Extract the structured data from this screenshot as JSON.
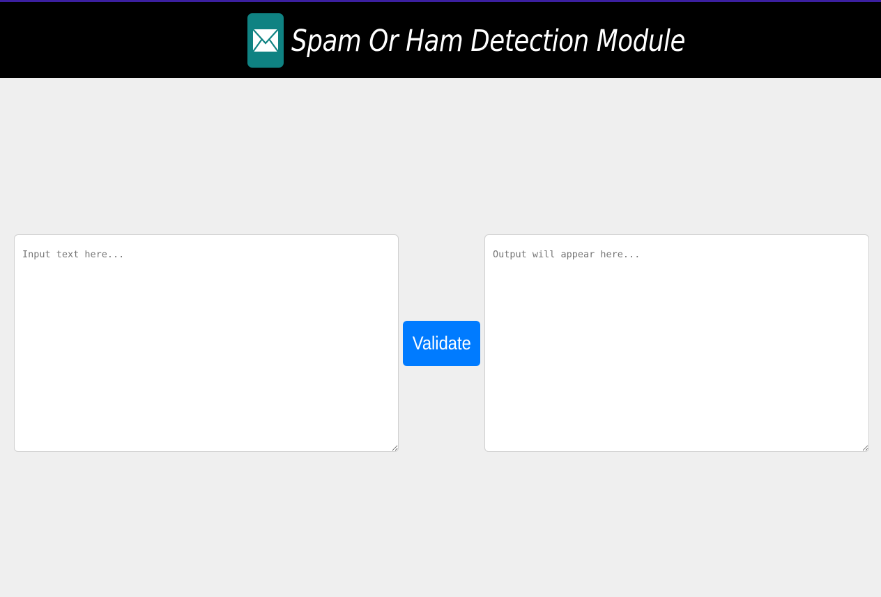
{
  "header": {
    "title": "Spam Or Ham Detection Module",
    "logo_icon": "mail-envelope-icon",
    "background": "#000000",
    "logo_background": "#0f8282",
    "top_accent": "#3b1fa0"
  },
  "input": {
    "placeholder": "Input text here...",
    "value": ""
  },
  "output": {
    "placeholder": "Output will appear here...",
    "value": ""
  },
  "validate_button": {
    "label": "Validate",
    "color": "#007bff"
  }
}
